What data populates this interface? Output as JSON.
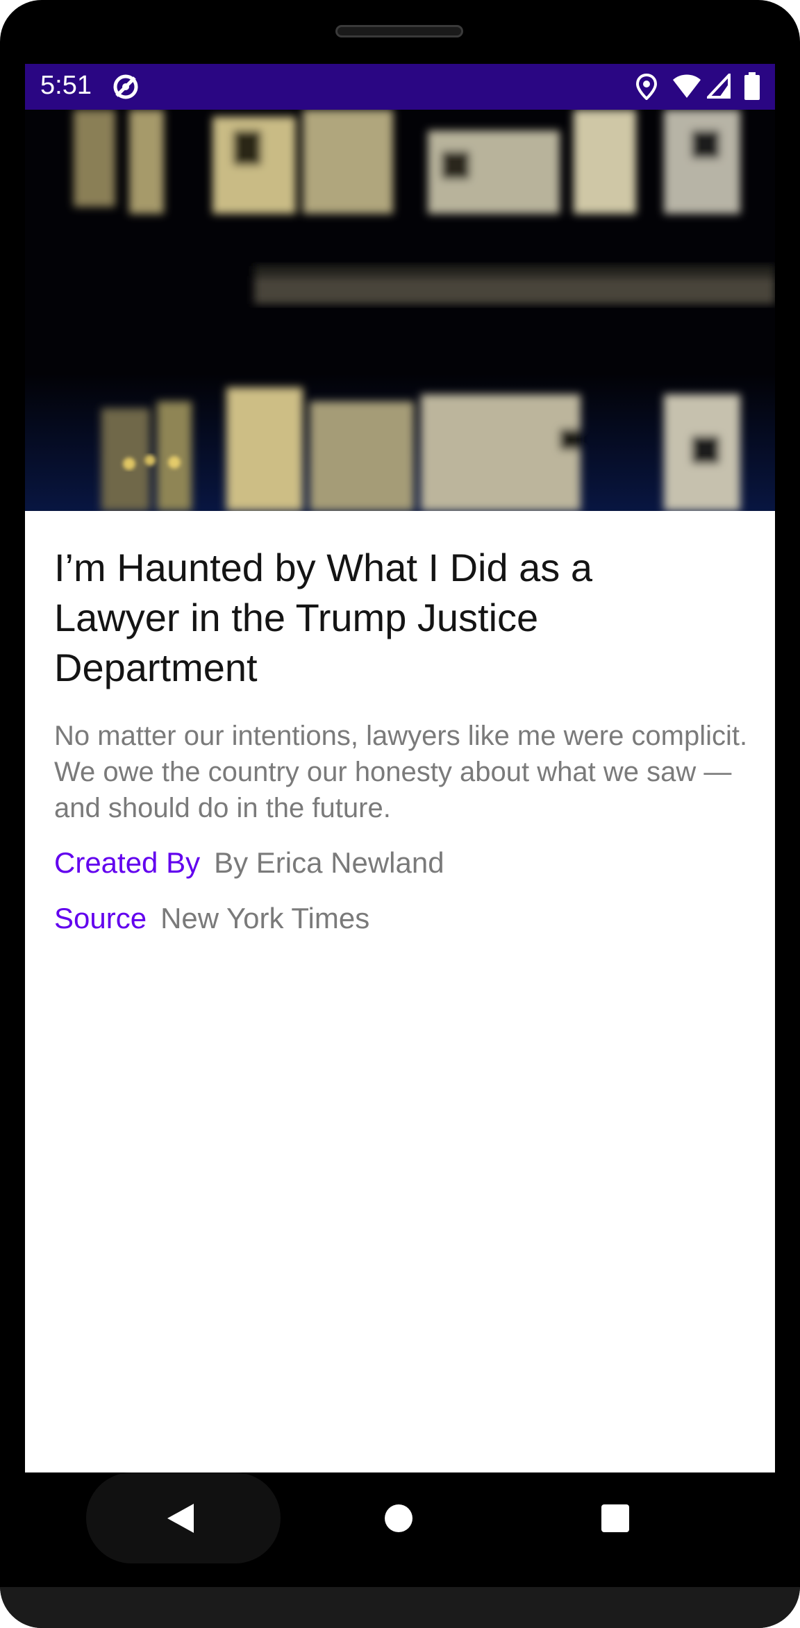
{
  "status_bar": {
    "time": "5:51",
    "background_color": "#2a0683",
    "icons": [
      "sync-disabled-icon",
      "location-icon",
      "wifi-icon",
      "signal-icon",
      "battery-icon"
    ]
  },
  "article": {
    "title": "I’m Haunted by What I Did as a Lawyer in the Trump Justice Department",
    "summary": "No matter our intentions, lawyers like me were complicit. We owe the country our honesty about what we saw — and should do in the future.",
    "created_by_label": "Created By",
    "created_by_value": "By Erica Newland",
    "source_label": "Source",
    "source_value": "New York Times",
    "accent_color": "#6200ee"
  },
  "navigation": {
    "icons": [
      "back-icon",
      "home-icon",
      "recents-icon"
    ]
  }
}
